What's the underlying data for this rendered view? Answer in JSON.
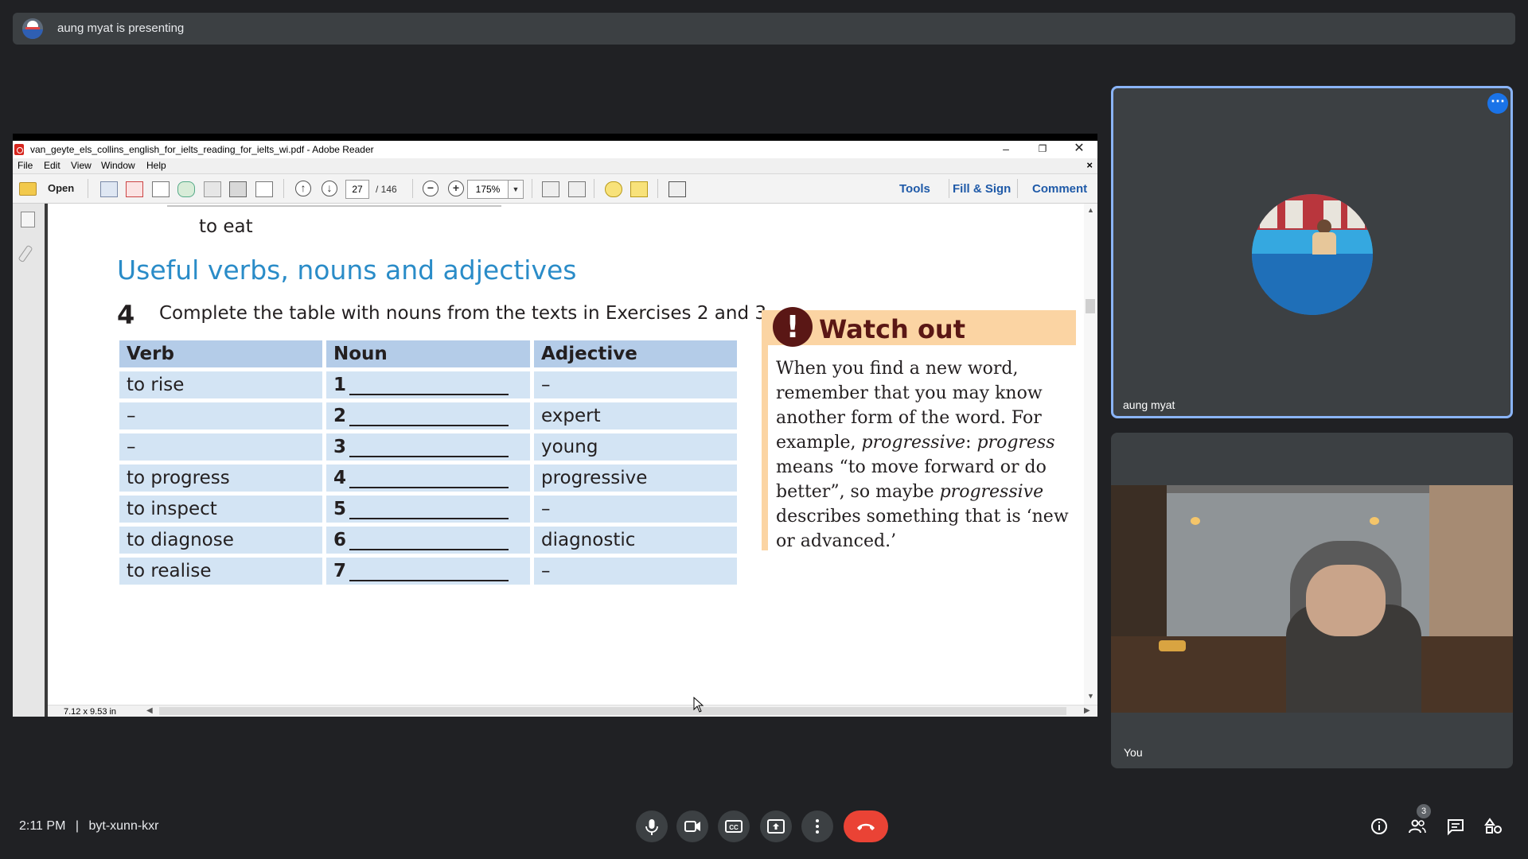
{
  "presenting": {
    "text": "aung myat is presenting"
  },
  "adobe": {
    "window_title": "van_geyte_els_collins_english_for_ielts_reading_for_ielts_wi.pdf - Adobe Reader",
    "menu": [
      "File",
      "Edit",
      "View",
      "Window",
      "Help"
    ],
    "toolbar": {
      "open_label": "Open",
      "page_current": "27",
      "page_total": "/ 146",
      "zoom": "175%",
      "tools_label": "Tools",
      "fill_sign_label": "Fill & Sign",
      "comment_label": "Comment"
    },
    "page_size": "7.12 x 9.53 in"
  },
  "pdf": {
    "prev_line": "to eat",
    "heading": "Useful verbs, nouns and adjectives",
    "exercise_number": "4",
    "instruction": "Complete the table with nouns from the texts in Exercises 2 and 3.",
    "table": {
      "headers": [
        "Verb",
        "Noun",
        "Adjective"
      ],
      "rows": [
        {
          "verb": "to rise",
          "num": "1",
          "adj": "–"
        },
        {
          "verb": "–",
          "num": "2",
          "adj": "expert"
        },
        {
          "verb": "–",
          "num": "3",
          "adj": "young"
        },
        {
          "verb": "to progress",
          "num": "4",
          "adj": "progressive"
        },
        {
          "verb": "to inspect",
          "num": "5",
          "adj": "–"
        },
        {
          "verb": "to diagnose",
          "num": "6",
          "adj": "diagnostic"
        },
        {
          "verb": "to realise",
          "num": "7",
          "adj": "–"
        }
      ]
    },
    "watch_out": {
      "icon": "!",
      "title": "Watch out",
      "text_1": "When you find a new word, remember that you may know another form of the word. For example, ",
      "em_1": "progressive",
      "text_2": ": ",
      "em_2": "progress",
      "text_3": " means “to move forward or do better”, so maybe ",
      "em_3": "progressive",
      "text_4": " describes something that is ‘new or advanced.’"
    }
  },
  "participants": [
    {
      "name": "aung myat"
    },
    {
      "name": "You"
    }
  ],
  "meeting": {
    "time": "2:11 PM",
    "separator": "|",
    "code": "byt-xunn-kxr",
    "people_count": "3"
  },
  "colors": {
    "accent": "#8ab4f8",
    "end_call": "#ea4335",
    "heading_blue": "#2a8cc8",
    "table_cell": "#d3e4f4",
    "watch_band": "#fbd4a3"
  }
}
